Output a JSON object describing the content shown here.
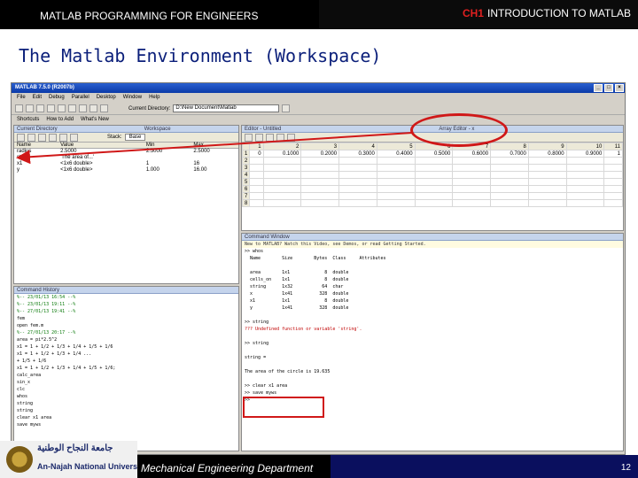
{
  "slide": {
    "course": "MATLAB PROGRAMMING FOR ENGINEERS",
    "chapter_prefix": "CH1",
    "chapter_title": "INTRODUCTION TO MATLAB",
    "title": "The Matlab Environment (Workspace)",
    "university_ar": "جامعة النجاح الوطنية",
    "university_en": "An-Najah National University",
    "department": "Mechanical Engineering Department",
    "page_number": "12"
  },
  "window": {
    "title": "MATLAB 7.5.0 (R2007b)",
    "menu": [
      "File",
      "Edit",
      "Debug",
      "Parallel",
      "Desktop",
      "Window",
      "Help"
    ],
    "current_directory_label": "Current Directory:",
    "current_directory_value": "D:\\New Document\\Matlab",
    "shortcuts": [
      "Shortcuts",
      "How to Add",
      "What's New"
    ]
  },
  "panels": {
    "current_directory_title": "Current Directory",
    "workspace_title": "Workspace",
    "editor_title": "Editor - Untitled",
    "array_editor_title": "Array Editor - x",
    "command_window_title": "Command Window",
    "command_history_title": "Command History",
    "stack_label": "Stack:",
    "stack_value": "Base"
  },
  "workspace": {
    "columns": [
      "Name",
      "Value",
      "Min",
      "Max"
    ],
    "rows": [
      {
        "name": "radius",
        "value": "2.5000",
        "min": "2.5000",
        "max": "2.5000"
      },
      {
        "name": "string",
        "value": "'The area of...'",
        "min": "",
        "max": ""
      },
      {
        "name": "x1",
        "value": "<1x6 double>",
        "min": "1",
        "max": "16"
      },
      {
        "name": "y",
        "value": "<1x6 double>",
        "min": "1.000",
        "max": "16.00"
      }
    ]
  },
  "array_editor": {
    "columns": [
      "1",
      "2",
      "3",
      "4",
      "5",
      "6",
      "7",
      "8",
      "9",
      "10",
      "11"
    ],
    "row1": [
      "0",
      "0.1000",
      "0.2000",
      "0.3000",
      "0.4000",
      "0.5000",
      "0.6000",
      "0.7000",
      "0.8000",
      "0.9000",
      "1"
    ],
    "rows": [
      "1",
      "2",
      "3",
      "4",
      "5",
      "6",
      "7",
      "8"
    ]
  },
  "command_window": {
    "notice": "New to MATLAB? Watch this Video, see Demos, or read Getting Started.",
    "lines": [
      ">> whos",
      "  Name        Size        Bytes  Class     Attributes",
      "",
      "  area        1x1             8  double",
      "  cells_on    1x1             8  double",
      "  string      1x32           64  char",
      "  x           1x41          328  double",
      "  x1          1x1             8  double",
      "  y           1x41          328  double",
      "",
      ">> string",
      "??? Undefined function or variable 'string'.",
      "",
      ">> string",
      "",
      "string =",
      "",
      "The area of the circle is 19.635",
      "",
      ">> clear x1 area",
      ">> save myws",
      ">>"
    ]
  },
  "command_history": {
    "lines": [
      "%-- 23/01/13 16:54 --%",
      "%-- 23/01/13 19:11 --%",
      "%-- 27/01/13 19:41 --%",
      "fem",
      "open fem.m",
      "%-- 27/01/13 20:17 --%",
      "area = pi*2.5^2",
      "x1 = 1 + 1/2 + 1/3 + 1/4 + 1/5 + 1/6",
      "x1 = 1 + 1/2 + 1/3 + 1/4 ...",
      "+ 1/5 + 1/6",
      "x1 = 1 + 1/2 + 1/3 + 1/4 + 1/5 + 1/6;",
      "calc_area",
      "sin_x",
      "clc",
      "whos",
      "string",
      "string",
      "clear x1 area",
      "save myws"
    ]
  }
}
